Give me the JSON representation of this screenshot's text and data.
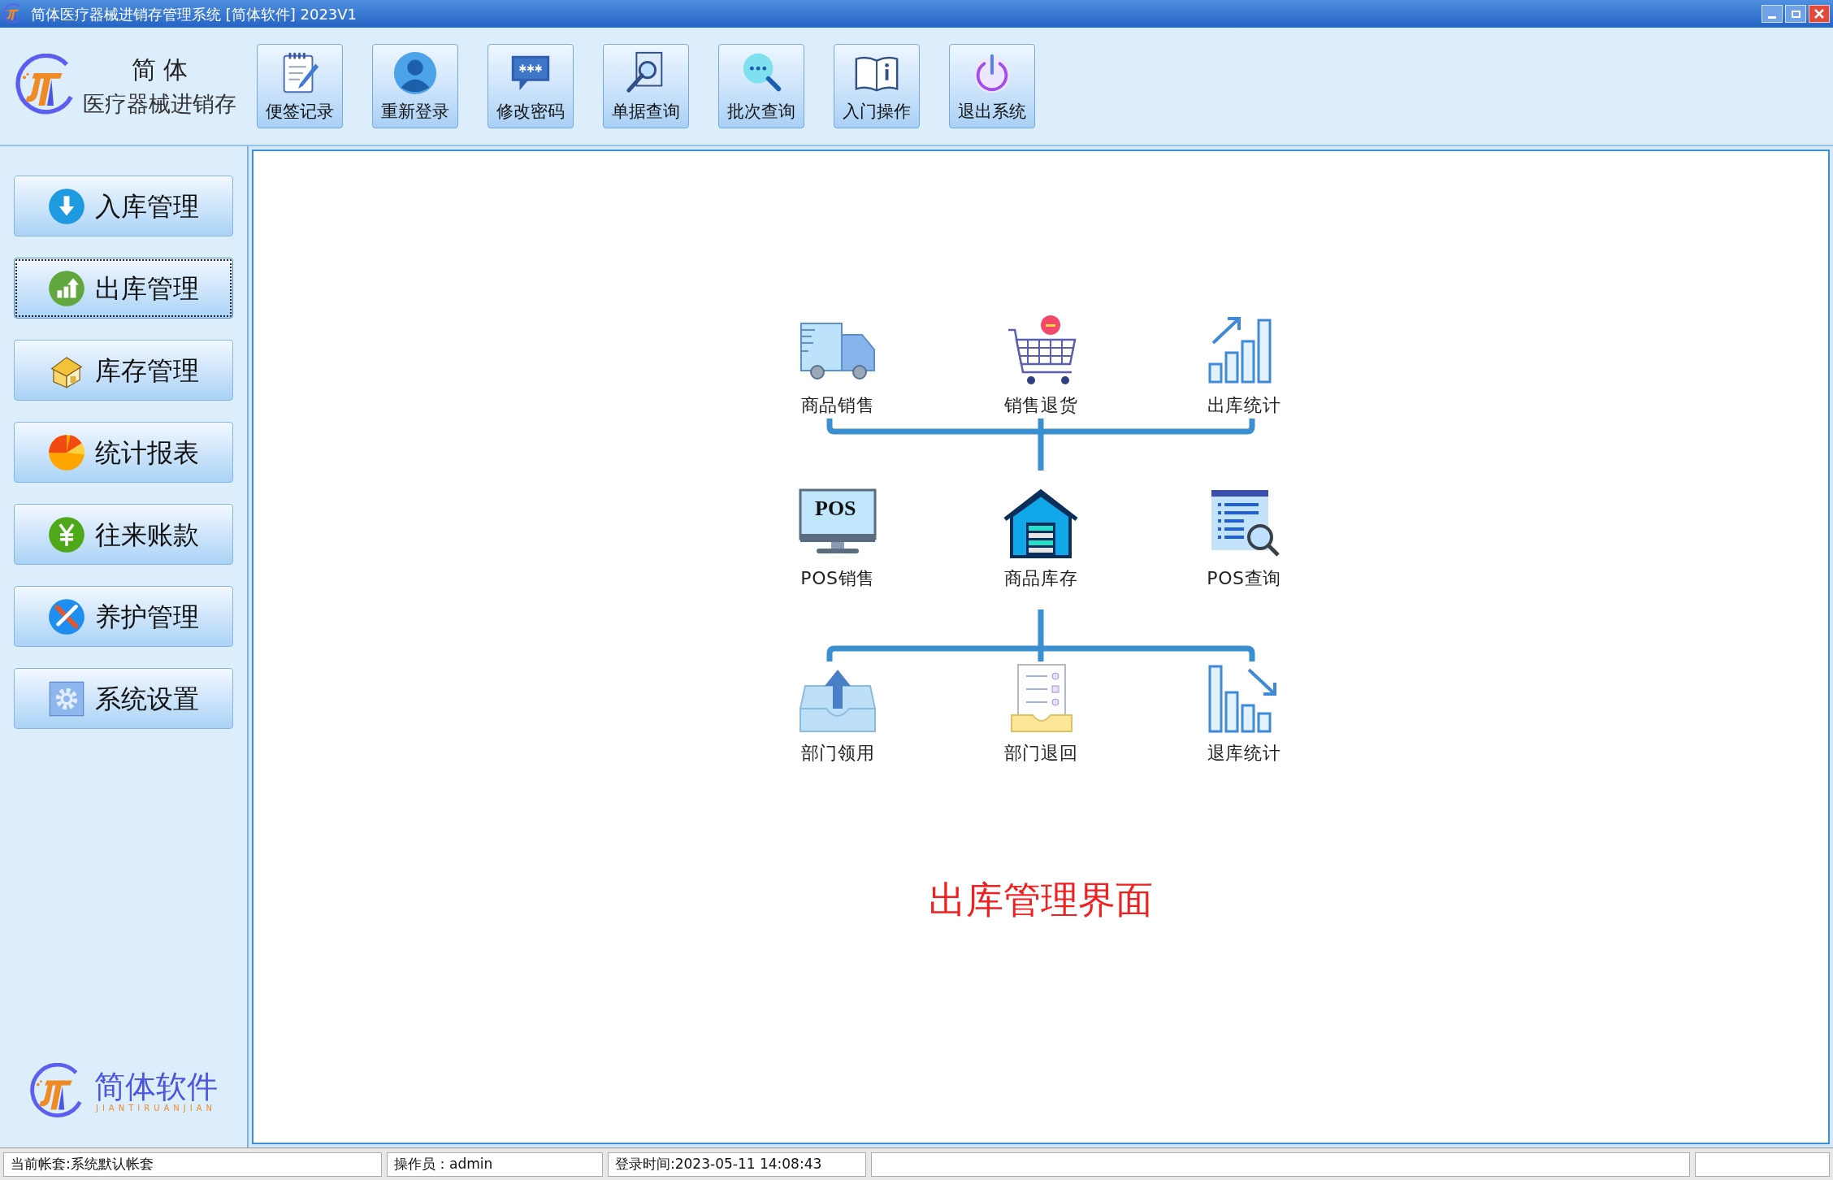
{
  "window": {
    "title": "简体医疗器械进销存管理系统 [简体软件] 2023V1"
  },
  "toolbar": {
    "logo": {
      "line1": "简 体",
      "line2": "医疗器械进销存"
    },
    "buttons": [
      {
        "label": "便签记录"
      },
      {
        "label": "重新登录"
      },
      {
        "label": "修改密码"
      },
      {
        "label": "单据查询"
      },
      {
        "label": "批次查询"
      },
      {
        "label": "入门操作"
      },
      {
        "label": "退出系统"
      }
    ]
  },
  "sidebar": {
    "items": [
      {
        "label": "入库管理",
        "selected": false
      },
      {
        "label": "出库管理",
        "selected": true
      },
      {
        "label": "库存管理",
        "selected": false
      },
      {
        "label": "统计报表",
        "selected": false
      },
      {
        "label": "往来账款",
        "selected": false
      },
      {
        "label": "养护管理",
        "selected": false
      },
      {
        "label": "系统设置",
        "selected": false
      }
    ],
    "brand": {
      "name": "简体软件",
      "pinyin": "JIANTIRUANJIAN"
    }
  },
  "diagram": {
    "top_row": [
      {
        "label": "商品销售"
      },
      {
        "label": "销售退货"
      },
      {
        "label": "出库统计"
      }
    ],
    "middle_row": [
      {
        "label": "POS销售",
        "screen_text": "POS"
      },
      {
        "label": "商品库存"
      },
      {
        "label": "POS查询"
      }
    ],
    "bottom_row": [
      {
        "label": "部门领用"
      },
      {
        "label": "部门退回"
      },
      {
        "label": "退库统计"
      }
    ],
    "caption": "出库管理界面"
  },
  "status_bar": [
    "当前帐套:系统默认帐套",
    "操作员：admin",
    "登录时间:2023-05-11 14:08:43"
  ]
}
